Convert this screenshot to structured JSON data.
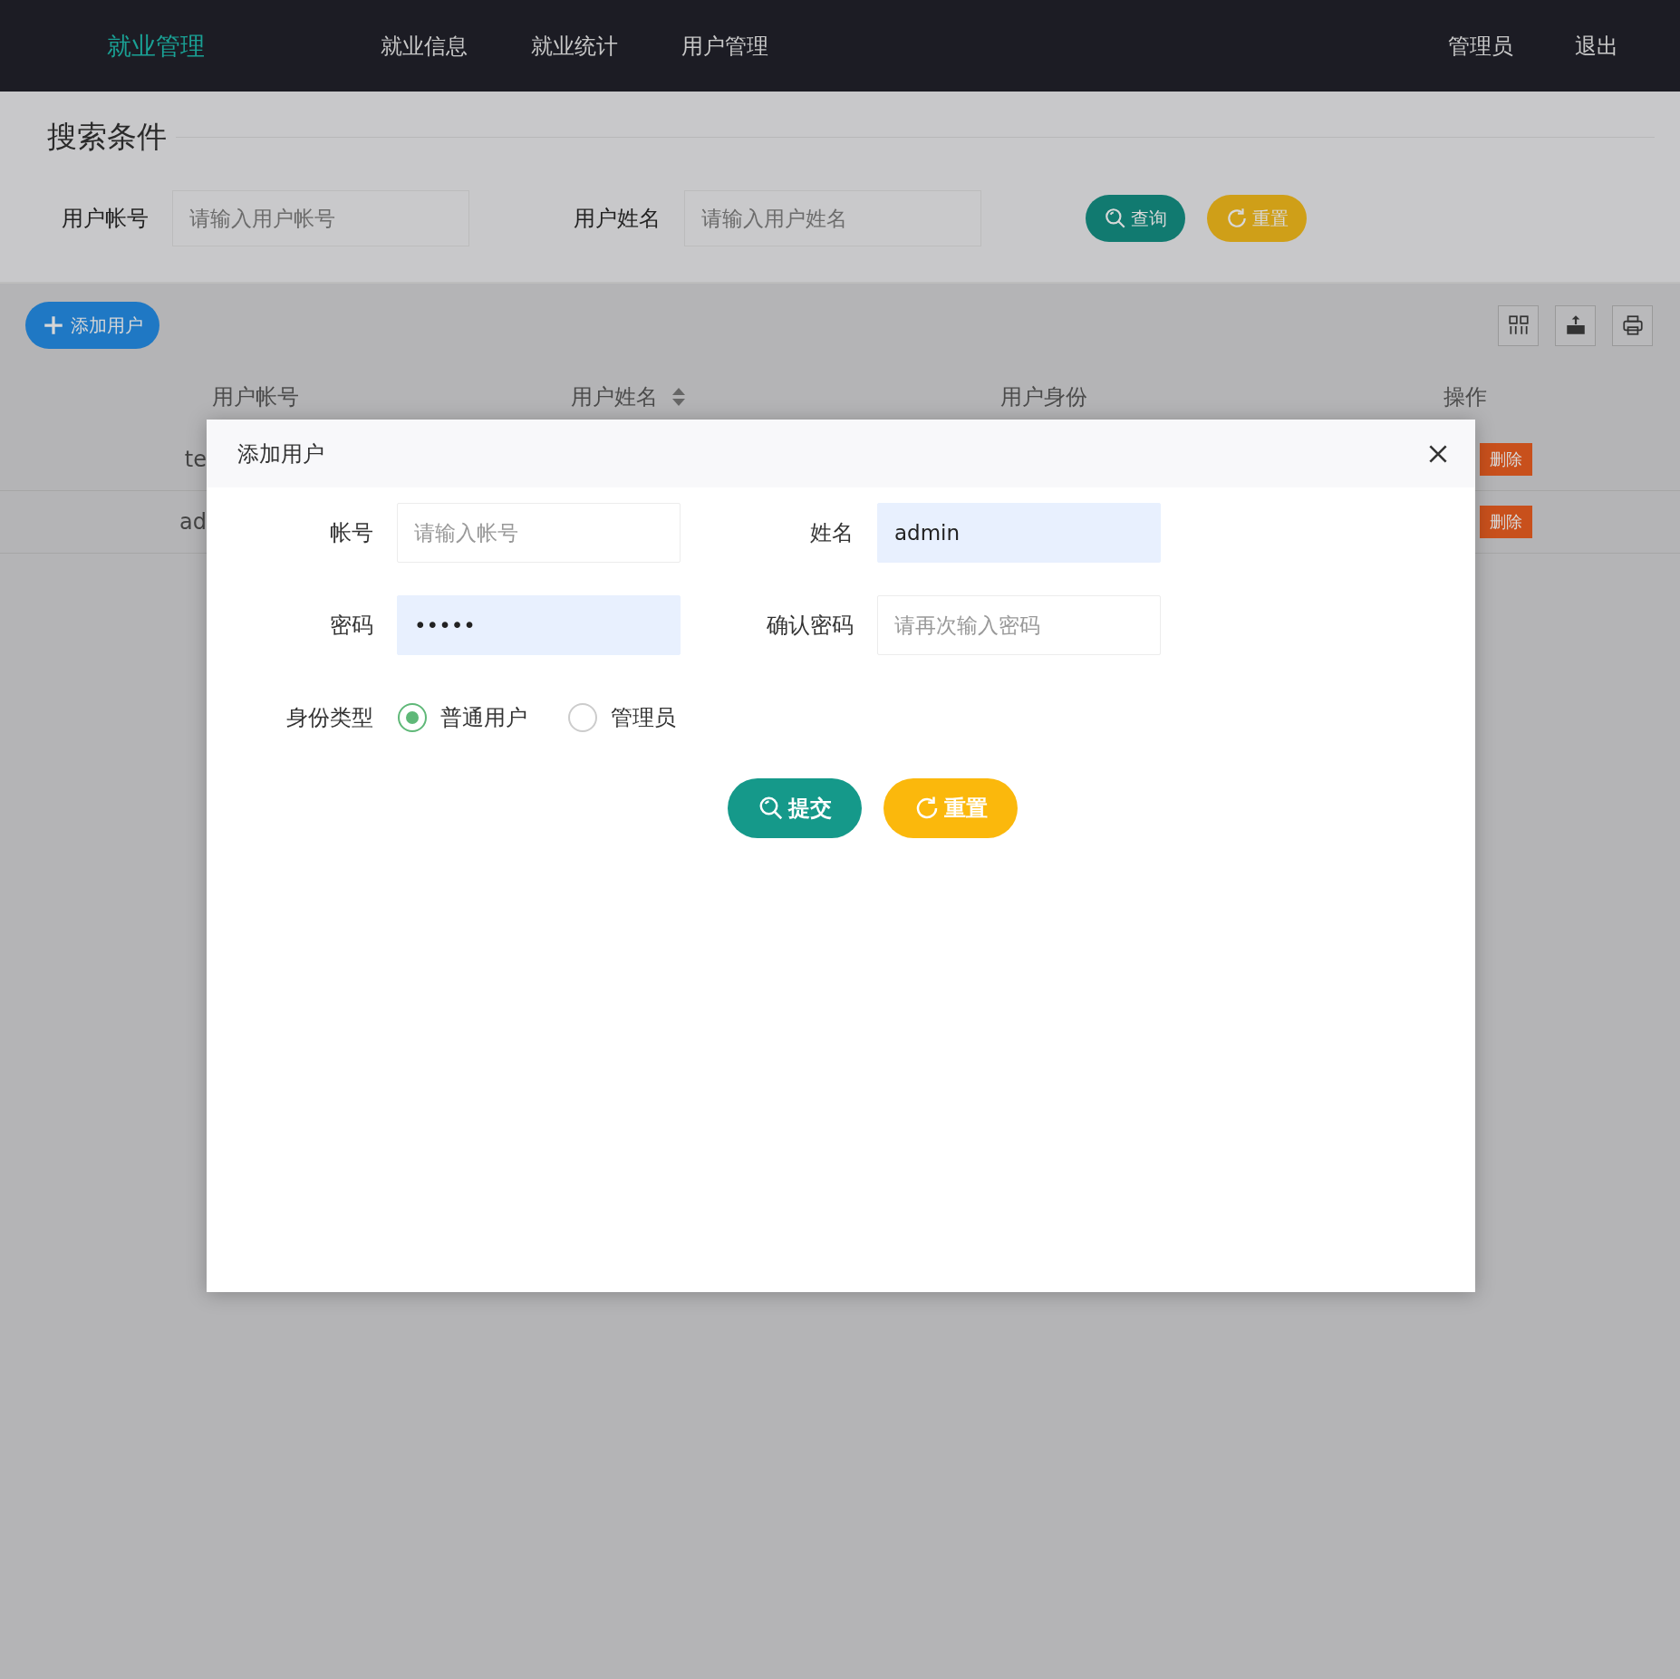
{
  "nav": {
    "logo": "就业管理",
    "items": [
      {
        "label": "就业信息"
      },
      {
        "label": "就业统计"
      },
      {
        "label": "用户管理"
      }
    ],
    "right": [
      {
        "label": "管理员"
      },
      {
        "label": "退出"
      }
    ]
  },
  "search": {
    "title": "搜索条件",
    "fields": [
      {
        "label": "用户帐号",
        "placeholder": "请输入用户帐号"
      },
      {
        "label": "用户姓名",
        "placeholder": "请输入用户姓名"
      }
    ],
    "buttons": [
      {
        "kind": "search",
        "label": "查询"
      },
      {
        "kind": "reset",
        "label": "重置"
      }
    ]
  },
  "toolbar": {
    "add_button": "添加用户"
  },
  "table": {
    "columns": [
      {
        "label": "用户帐号",
        "sortable": false
      },
      {
        "label": "用户姓名",
        "sortable": true
      },
      {
        "label": "用户身份",
        "sortable": false
      },
      {
        "label": "操作",
        "sortable": false
      }
    ],
    "rows": [
      {
        "column_1": "te",
        "action": "删除"
      },
      {
        "column_1": "ad",
        "action": "删除"
      }
    ]
  },
  "dialog": {
    "title": "添加用户",
    "fields": [
      {
        "label": "帐号",
        "placeholder": "请输入帐号"
      },
      {
        "label": "姓名",
        "value": "admin"
      },
      {
        "label": "密码",
        "value": "•••••"
      },
      {
        "label": "确认密码",
        "placeholder": "请再次输入密码"
      }
    ],
    "radio": {
      "label": "身份类型",
      "options": [
        {
          "label": "普通用户",
          "selected": true
        },
        {
          "label": "管理员",
          "selected": false
        }
      ]
    },
    "buttons": [
      {
        "kind": "search",
        "label": "提交"
      },
      {
        "kind": "reset",
        "label": "重置"
      }
    ]
  }
}
